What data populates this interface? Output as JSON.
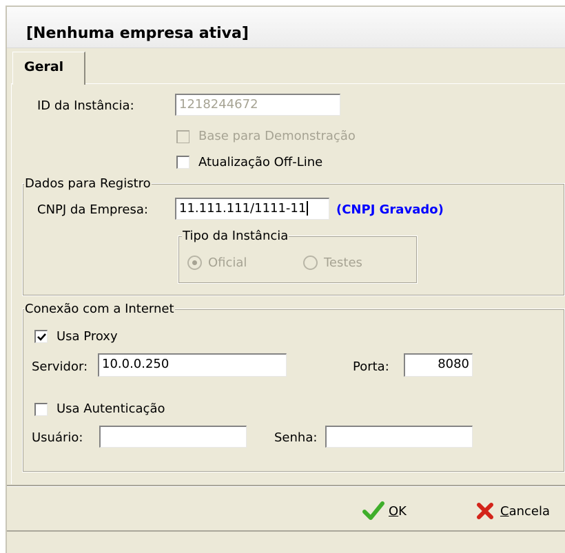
{
  "window": {
    "title": "[Nenhuma empresa ativa]"
  },
  "tabs": [
    {
      "label": "Geral",
      "active": true
    }
  ],
  "general": {
    "instance_id_label": "ID da Instância:",
    "instance_id_value": "1218244672",
    "demo_base_label": "Base para Demonstração",
    "demo_base_checked": false,
    "demo_base_enabled": false,
    "offline_update_label": "Atualização Off-Line",
    "offline_update_checked": false
  },
  "registration": {
    "group_title": "Dados para Registro",
    "cnpj_label": "CNPJ da Empresa:",
    "cnpj_value": "11.111.111/1111-11",
    "cnpj_status": "(CNPJ Gravado)",
    "cnpj_status_color": "#0000ff",
    "instance_type": {
      "group_title": "Tipo da Instância",
      "options": [
        "Oficial",
        "Testes"
      ],
      "selected": "Oficial",
      "enabled": false
    }
  },
  "internet": {
    "group_title": "Conexão com a Internet",
    "use_proxy_label": "Usa Proxy",
    "use_proxy_checked": true,
    "server_label": "Servidor:",
    "server_value": "10.0.0.250",
    "port_label": "Porta:",
    "port_value": "8080",
    "use_auth_label": "Usa Autenticação",
    "use_auth_checked": false,
    "user_label": "Usuário:",
    "user_value": "",
    "password_label": "Senha:",
    "password_value": ""
  },
  "buttons": {
    "ok": {
      "label_prefix": "",
      "underlined": "O",
      "label_rest": "K",
      "icon": "green-check-icon",
      "color": "#3fae2a"
    },
    "cancel": {
      "label_prefix": "",
      "underlined": "C",
      "label_rest": "ancela",
      "icon": "red-x-icon",
      "color": "#d3241a"
    }
  }
}
